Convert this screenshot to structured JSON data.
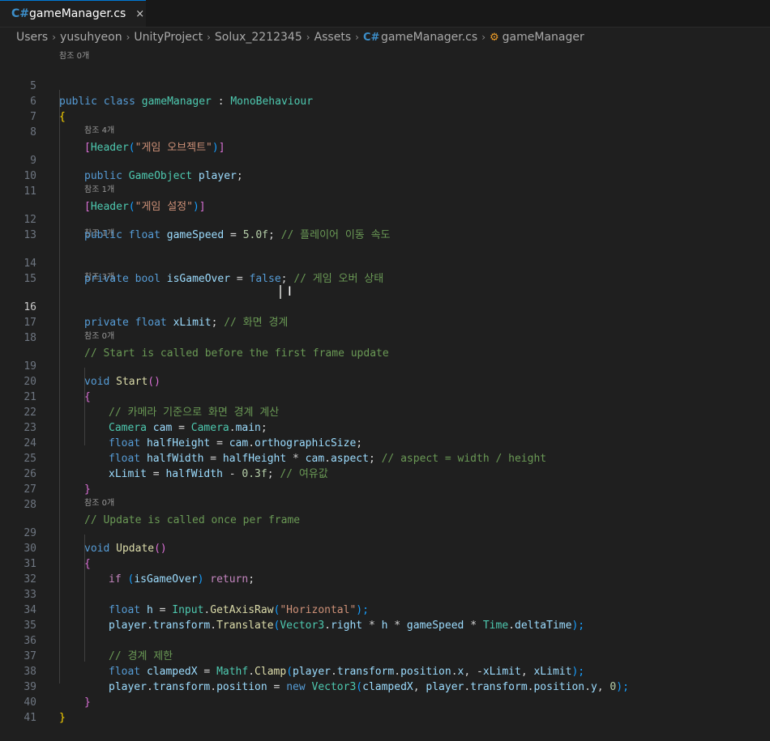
{
  "tab": {
    "icon": "csharp-file-icon",
    "icon_glyph": "C#",
    "label": "gameManager.cs",
    "close": "×"
  },
  "breadcrumb": {
    "items": [
      "Users",
      "yusuhyeon",
      "UnityProject",
      "Solux_2212345",
      "Assets",
      "gameManager.cs",
      "gameManager"
    ],
    "separator": "›"
  },
  "editor": {
    "lines": [
      {
        "n": "5",
        "lens": "참조 0개"
      },
      {
        "n": "6"
      },
      {
        "n": "7"
      },
      {
        "n": "8"
      },
      {
        "n": "9",
        "lens": "참조 4개"
      },
      {
        "n": "10"
      },
      {
        "n": "11"
      },
      {
        "n": "12",
        "lens": "참조 1개"
      },
      {
        "n": "13"
      },
      {
        "n": "14",
        "lens": "참조 1개"
      },
      {
        "n": "15"
      },
      {
        "n": "16",
        "lens": "참조 3개"
      },
      {
        "n": "17"
      },
      {
        "n": "18"
      },
      {
        "n": "19",
        "lens": "참조 0개"
      },
      {
        "n": "20"
      },
      {
        "n": "21"
      },
      {
        "n": "22"
      },
      {
        "n": "23"
      },
      {
        "n": "24"
      },
      {
        "n": "25"
      },
      {
        "n": "26"
      },
      {
        "n": "27"
      },
      {
        "n": "28"
      },
      {
        "n": "29",
        "lens": "참조 0개"
      },
      {
        "n": "30"
      },
      {
        "n": "31"
      },
      {
        "n": "32"
      },
      {
        "n": "33"
      },
      {
        "n": "34"
      },
      {
        "n": "35"
      },
      {
        "n": "36"
      },
      {
        "n": "37"
      },
      {
        "n": "38"
      },
      {
        "n": "39"
      },
      {
        "n": "40"
      },
      {
        "n": "41"
      }
    ],
    "active_line": "16",
    "code": {
      "l5": [
        "public",
        "class",
        "gameManager",
        ":",
        "MonoBehaviour"
      ],
      "l6": [
        "{"
      ],
      "l8": [
        "[",
        "Header",
        "(",
        "\"게임 오브젝트\"",
        ")",
        "]"
      ],
      "l9": [
        "public",
        "GameObject",
        "player",
        ";"
      ],
      "l11": [
        "[",
        "Header",
        "(",
        "\"게임 설정\"",
        ")",
        "]"
      ],
      "l12": [
        "public",
        "float",
        "gameSpeed",
        " = ",
        "5.0f",
        ";",
        "// 플레이어 이동 속도"
      ],
      "l14": [
        "private",
        "bool",
        "isGameOver",
        " = ",
        "false",
        ";",
        "// 게임 오버 상태"
      ],
      "l16": [
        "private",
        "float",
        "xLimit",
        ";",
        "// 화면 경계"
      ],
      "l18": [
        "// Start is called before the first frame update"
      ],
      "l19": [
        "void",
        "Start",
        "()"
      ],
      "l20": [
        "{"
      ],
      "l21": [
        "// 카메라 기준으로 화면 경계 계산"
      ],
      "l22": [
        "Camera",
        "cam",
        " = ",
        "Camera",
        ".",
        "main",
        ";"
      ],
      "l23": [
        "float",
        "halfHeight",
        " = ",
        "cam",
        ".",
        "orthographicSize",
        ";"
      ],
      "l24": [
        "float",
        "halfWidth",
        " = ",
        "halfHeight",
        " * ",
        "cam",
        ".",
        "aspect",
        ";",
        "// aspect = width / height"
      ],
      "l25": [
        "xLimit",
        " = ",
        "halfWidth",
        " - ",
        "0.3f",
        ";",
        "// 여유값"
      ],
      "l26": [
        "}"
      ],
      "l28": [
        "// Update is called once per frame"
      ],
      "l29": [
        "void",
        "Update",
        "()"
      ],
      "l30": [
        "{"
      ],
      "l31": [
        "if",
        "(",
        "isGameOver",
        ")",
        "return",
        ";"
      ],
      "l33": [
        "float",
        "h",
        " = ",
        "Input",
        ".",
        "GetAxisRaw",
        "(",
        "\"Horizontal\"",
        ");"
      ],
      "l34": [
        "player",
        ".",
        "transform",
        ".",
        "Translate",
        "(",
        "Vector3",
        ".",
        "right",
        " * ",
        "h",
        " * ",
        "gameSpeed",
        " * ",
        "Time",
        ".",
        "deltaTime",
        ");"
      ],
      "l36": [
        "// 경계 제한"
      ],
      "l37": [
        "float",
        "clampedX",
        " = ",
        "Mathf",
        ".",
        "Clamp",
        "(",
        "player",
        ".",
        "transform",
        ".",
        "position",
        ".",
        "x",
        ", -",
        "xLimit",
        ", ",
        "xLimit",
        ");"
      ],
      "l38": [
        "player",
        ".",
        "transform",
        ".",
        "position",
        " = ",
        "new",
        "Vector3",
        "(",
        "clampedX",
        ", ",
        "player",
        ".",
        "transform",
        ".",
        "position",
        ".",
        "y",
        ", ",
        "0",
        ");"
      ],
      "l39": [
        "}"
      ],
      "l40": [
        "}"
      ]
    }
  },
  "colors": {
    "background": "#1f1f1f",
    "keyword": "#569cd6",
    "type": "#4ec9b0",
    "function": "#dcdcaa",
    "variable": "#9cdcfe",
    "string": "#ce9178",
    "number": "#b5cea8",
    "comment": "#6a9955",
    "control": "#c586c0"
  }
}
